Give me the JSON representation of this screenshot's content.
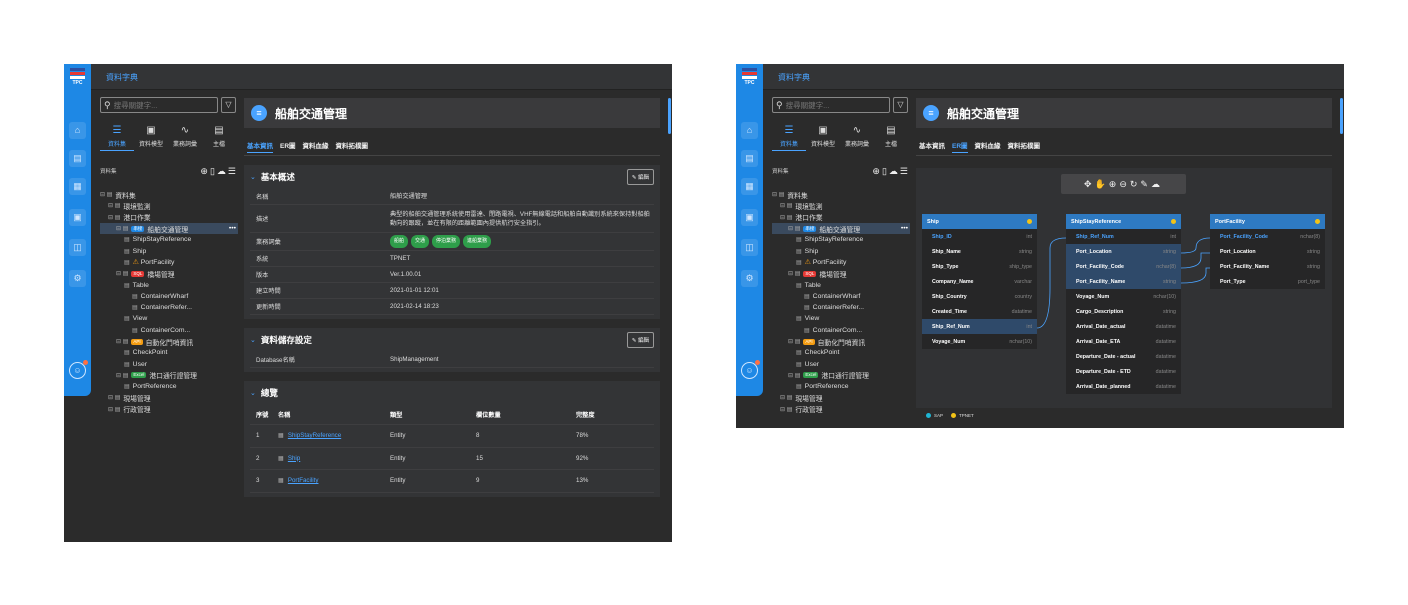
{
  "app": {
    "title": "資料字典",
    "logo_text": "TPC",
    "accent": "#4aa3ff",
    "rail_color": "#1e88e5",
    "rail_icons": [
      "home-icon",
      "book-icon",
      "database-icon",
      "document-icon",
      "open-book-icon",
      "gear-icon"
    ]
  },
  "sidebar": {
    "search_placeholder": "搜尋關鍵字...",
    "categories": [
      {
        "label": "資料集",
        "icon": "list-icon",
        "active": true
      },
      {
        "label": "資料模型",
        "icon": "model-icon",
        "active": false
      },
      {
        "label": "業務詞彙",
        "icon": "term-icon",
        "active": false
      },
      {
        "label": "主檔",
        "icon": "master-icon",
        "active": false
      }
    ],
    "section_label": "資料集",
    "tree": [
      {
        "label": "資料集",
        "level": 0
      },
      {
        "label": "環境監測",
        "level": 1
      },
      {
        "label": "港口作業",
        "level": 1
      },
      {
        "label": "船舶交通管理",
        "level": 2,
        "tag": "串接",
        "tag_color": "#1e88e5",
        "selected": true
      },
      {
        "label": "ShipStayReference",
        "level": 3
      },
      {
        "label": "Ship",
        "level": 3
      },
      {
        "label": "PortFacility",
        "level": 3,
        "warn": true
      },
      {
        "label": "橋場管理",
        "level": 2,
        "tag": "SQL",
        "tag_color": "#e53935"
      },
      {
        "label": "Table",
        "level": 3
      },
      {
        "label": "ContainerWharf",
        "level": 4
      },
      {
        "label": "ContainerRefer...",
        "level": 4
      },
      {
        "label": "View",
        "level": 3
      },
      {
        "label": "ContainerCom...",
        "level": 4
      },
      {
        "label": "自動化門哨資訊",
        "level": 2,
        "tag": "API",
        "tag_color": "#f39c12"
      },
      {
        "label": "CheckPoint",
        "level": 3
      },
      {
        "label": "User",
        "level": 3
      },
      {
        "label": "港口通行證管理",
        "level": 2,
        "tag": "Excel",
        "tag_color": "#2e9e4a"
      },
      {
        "label": "PortReference",
        "level": 3
      },
      {
        "label": "現場管理",
        "level": 1
      },
      {
        "label": "行政管理",
        "level": 1
      }
    ]
  },
  "detail": {
    "title": "船舶交通管理",
    "tabs": [
      "基本資訊",
      "ER圖",
      "資料血緣",
      "資料拓樸圖"
    ],
    "overview": {
      "heading": "基本概述",
      "edit_label": "編輯",
      "rows": [
        {
          "key": "名稱",
          "value": "船舶交通管理"
        },
        {
          "key": "描述",
          "value": "典型的船舶交通管理系統使用雷達、閉路電視、VHF無線電話和船舶自動識別系統來保持對船舶動向的跟蹤，並在有限的距離範圍內提供航行安全指引。"
        },
        {
          "key": "業務詞彙",
          "chips": [
            "船舶",
            "交通",
            "停泊業務",
            "進船業務"
          ]
        },
        {
          "key": "系統",
          "value": "TPNET"
        },
        {
          "key": "版本",
          "value": "Ver.1.00.01"
        },
        {
          "key": "建立時間",
          "value": "2021-01-01 12:01"
        },
        {
          "key": "更新時間",
          "value": "2021-02-14 18:23"
        }
      ]
    },
    "storage": {
      "heading": "資料儲存設定",
      "edit_label": "編輯",
      "rows": [
        {
          "key": "Database名稱",
          "value": "ShipManagement"
        }
      ]
    },
    "summary": {
      "heading": "總覽",
      "columns": [
        "序號",
        "名稱",
        "類型",
        "欄位數量",
        "完整度"
      ],
      "rows": [
        [
          "1",
          "ShipStayReference",
          "Entity",
          "8",
          "78%"
        ],
        [
          "2",
          "Ship",
          "Entity",
          "15",
          "92%"
        ],
        [
          "3",
          "PortFacility",
          "Entity",
          "9",
          "13%"
        ]
      ]
    }
  },
  "er": {
    "toolbar_icons": [
      "move-icon",
      "hand-icon",
      "zoom-in-icon",
      "zoom-out-icon",
      "refresh-icon",
      "pen-icon",
      "cloud-icon"
    ],
    "entities": [
      {
        "name": "Ship",
        "rows": [
          {
            "field": "Ship_ID",
            "type": "int",
            "key": true
          },
          {
            "field": "Ship_Name",
            "type": "string"
          },
          {
            "field": "Ship_Type",
            "type": "ship_type"
          },
          {
            "field": "Company_Name",
            "type": "varchar"
          },
          {
            "field": "Ship_Country",
            "type": "country"
          },
          {
            "field": "Created_Time",
            "type": "datatime"
          },
          {
            "field": "Ship_Ref_Num",
            "type": "int",
            "hl": true
          },
          {
            "field": "Voyage_Num",
            "type": "nchar(10)"
          }
        ]
      },
      {
        "name": "ShipStayReference",
        "rows": [
          {
            "field": "Ship_Ref_Num",
            "type": "int",
            "key": true
          },
          {
            "field": "Port_Location",
            "type": "string",
            "hl": true
          },
          {
            "field": "Port_Facility_Code",
            "type": "nchar(8)",
            "hl": true
          },
          {
            "field": "Port_Facility_Name",
            "type": "string",
            "hl": true
          },
          {
            "field": "Voyage_Num",
            "type": "nchar(10)"
          },
          {
            "field": "Cargo_Description",
            "type": "string"
          },
          {
            "field": "Arrival_Date_actual",
            "type": "datatime"
          },
          {
            "field": "Arrival_Date_ETA",
            "type": "datatime"
          },
          {
            "field": "Departure_Date - actual",
            "type": "datatime"
          },
          {
            "field": "Departure_Date - ETD",
            "type": "datatime"
          },
          {
            "field": "Arrival_Date_planned",
            "type": "datatime"
          }
        ]
      },
      {
        "name": "PortFacility",
        "rows": [
          {
            "field": "Port_Facility_Code",
            "type": "nchar(8)",
            "key": true
          },
          {
            "field": "Port_Location",
            "type": "string"
          },
          {
            "field": "Port_Facility_Name",
            "type": "string"
          },
          {
            "field": "Port_Type",
            "type": "port_type"
          }
        ]
      }
    ],
    "legend": [
      {
        "label": "SAP",
        "color": "#1fb6d4"
      },
      {
        "label": "TPNET",
        "color": "#f3c317"
      }
    ]
  }
}
